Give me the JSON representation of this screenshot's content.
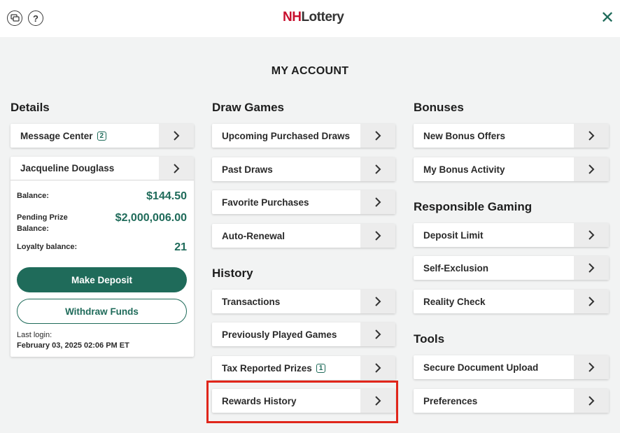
{
  "header": {
    "logo_nh": "NH",
    "logo_lottery": "Lottery",
    "help_glyph": "?",
    "close_glyph": "✕",
    "icons": [
      "chat-icon",
      "help-icon",
      "close-icon"
    ]
  },
  "page": {
    "title": "MY ACCOUNT"
  },
  "details": {
    "title": "Details",
    "message_center": {
      "label": "Message Center",
      "badge": "2"
    },
    "account": {
      "name": "Jacqueline Douglass",
      "balance_label": "Balance:",
      "balance_value": "$144.50",
      "pending_label_1": "Pending Prize",
      "pending_label_2": "Balance:",
      "pending_value": "$2,000,006.00",
      "loyalty_label": "Loyalty balance:",
      "loyalty_value": "21",
      "deposit_button": "Make Deposit",
      "withdraw_button": "Withdraw Funds",
      "last_login_label": "Last login:",
      "last_login_value": "February 03, 2025 02:06 PM ET"
    }
  },
  "draw_games": {
    "title": "Draw Games",
    "items": [
      "Upcoming Purchased Draws",
      "Past Draws",
      "Favorite Purchases",
      "Auto-Renewal"
    ]
  },
  "history": {
    "title": "History",
    "items": [
      {
        "label": "Transactions",
        "badge": ""
      },
      {
        "label": "Previously Played Games",
        "badge": ""
      },
      {
        "label": "Tax Reported Prizes",
        "badge": "1"
      },
      {
        "label": "Rewards History",
        "badge": ""
      }
    ]
  },
  "bonuses": {
    "title": "Bonuses",
    "items": [
      "New Bonus Offers",
      "My Bonus Activity"
    ]
  },
  "responsible_gaming": {
    "title": "Responsible Gaming",
    "items": [
      "Deposit Limit",
      "Self-Exclusion",
      "Reality Check"
    ]
  },
  "tools": {
    "title": "Tools",
    "items": [
      "Secure Document Upload",
      "Preferences"
    ]
  },
  "colors": {
    "accent": "#1f6b5a",
    "logo_red": "#c8102e",
    "highlight": "#e0261b",
    "background": "#f2f3f3"
  }
}
